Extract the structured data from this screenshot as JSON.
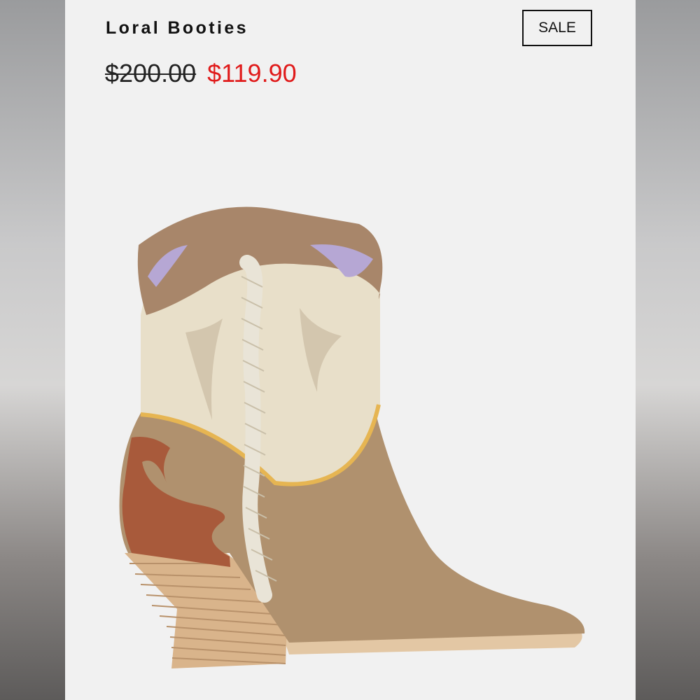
{
  "product": {
    "title": "Loral Booties",
    "badge": "SALE",
    "original_price": "$200.00",
    "sale_price": "$119.90"
  },
  "image": {
    "icon": "boot-product-image"
  },
  "colors": {
    "card_background": "#f1f1f1",
    "sale_price": "#e01b1b",
    "text": "#111111"
  }
}
